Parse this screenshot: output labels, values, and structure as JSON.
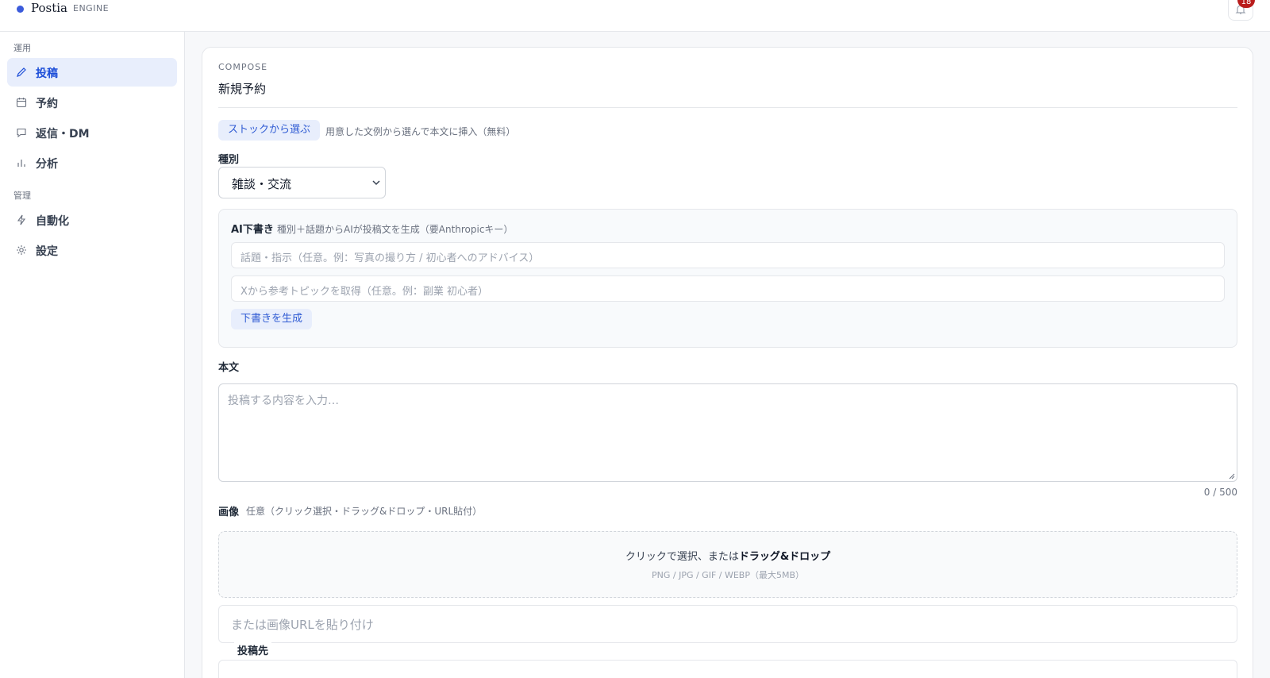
{
  "app": {
    "name": "Postia",
    "sub": "ENGINE",
    "notification_count": "18"
  },
  "sidebar": {
    "sections": [
      {
        "label": "運用"
      },
      {
        "label": "管理"
      }
    ],
    "items": [
      {
        "label": "投稿",
        "icon": "pencil-icon",
        "active": true
      },
      {
        "label": "予約",
        "icon": "calendar-icon"
      },
      {
        "label": "返信・DM",
        "icon": "chat-icon"
      },
      {
        "label": "分析",
        "icon": "bar-chart-icon"
      },
      {
        "label": "自動化",
        "icon": "bolt-icon"
      },
      {
        "label": "設定",
        "icon": "gear-icon"
      }
    ]
  },
  "compose": {
    "eyebrow": "COMPOSE",
    "title": "新規予約",
    "stock_button": "ストックから選ぶ",
    "stock_hint": "用意した文例から選んで本文に挿入（無料）",
    "type_label": "種別",
    "type_value": "雑談・交流",
    "ai": {
      "title": "AI下書き",
      "hint": "種別＋話題からAIが投稿文を生成（要Anthropicキー）",
      "topic_placeholder": "話題・指示（任意。例：写真の撮り方 / 初心者へのアドバイス）",
      "x_placeholder": "Xから参考トピックを取得（任意。例：副業 初心者）",
      "generate_button": "下書きを生成"
    },
    "body_label": "本文",
    "body_placeholder": "投稿する内容を入力…",
    "counter": "0 / 500",
    "image_label": "画像",
    "image_hint": "任意（クリック選択・ドラッグ&ドロップ・URL貼付）",
    "dropzone_text": "クリックで選択、または",
    "dropzone_bold": "ドラッグ&ドロップ",
    "dropzone_formats": "PNG / JPG / GIF / WEBP（最大5MB）",
    "url_placeholder": "または画像URLを貼り付け",
    "destination_label": "投稿先"
  },
  "colors": {
    "accent": "#2f5bd3",
    "accent_bg": "#e8eefc",
    "badge": "#b91c1c"
  }
}
